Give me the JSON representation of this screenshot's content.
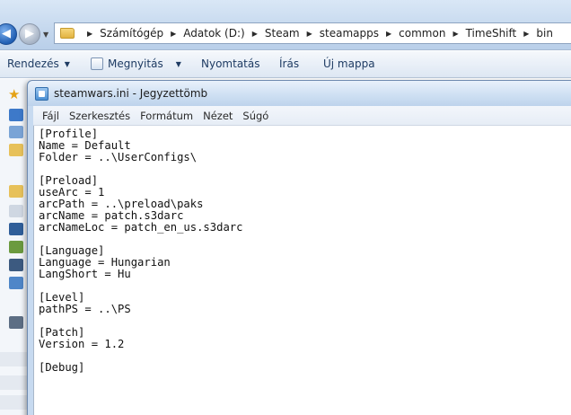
{
  "explorer": {
    "breadcrumb": [
      "Számítógép",
      "Adatok (D:)",
      "Steam",
      "steamapps",
      "common",
      "TimeShift",
      "bin"
    ],
    "toolbar": {
      "organize": "Rendezés",
      "open": "Megnyitás",
      "print": "Nyomtatás",
      "burn": "Írás",
      "new_folder": "Új mappa"
    }
  },
  "notepad": {
    "title": "steamwars.ini - Jegyzettömb",
    "menu": [
      "Fájl",
      "Szerkesztés",
      "Formátum",
      "Nézet",
      "Súgó"
    ],
    "content": "[Profile]\nName = Default\nFolder = ..\\UserConfigs\\\n\n[Preload]\nuseArc = 1\narcPath = ..\\preload\\paks\narcName = patch.s3darc\narcNameLoc = patch_en_us.s3darc\n\n[Language]\nLanguage = Hungarian\nLangShort = Hu\n\n[Level]\npathPS = ..\\PS\n\n[Patch]\nVersion = 1.2\n\n[Debug]"
  },
  "colors": {
    "titlebar": "#cfe0f3",
    "toolbar_text": "#1e3b63",
    "editor_bg": "#ffffff"
  }
}
